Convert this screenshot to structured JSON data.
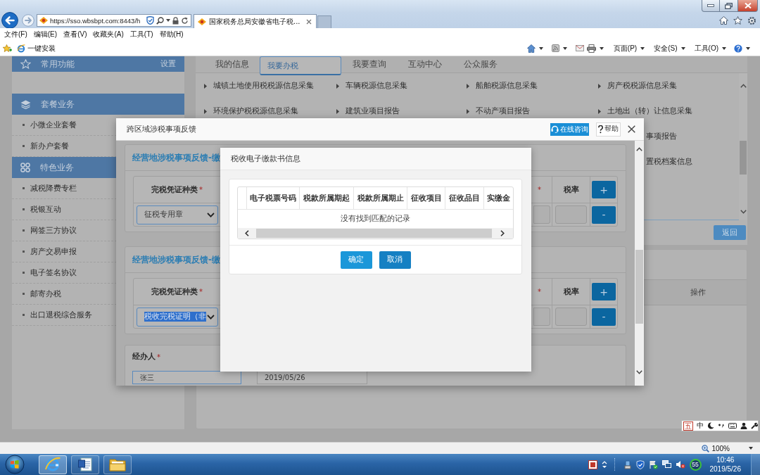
{
  "browser": {
    "address": "https://sso.wbsbpt.com:8443/h",
    "tab_title": "国家税务总局安徽省电子税...",
    "menu": [
      "文件(F)",
      "编辑(E)",
      "查看(V)",
      "收藏夹(A)",
      "工具(T)",
      "帮助(H)"
    ],
    "favorites": [
      "一键安装"
    ],
    "commands": [
      "页面(P)",
      "安全(S)",
      "工具(O)"
    ]
  },
  "sidebar": {
    "sections": [
      {
        "title": "常用功能",
        "action": "设置"
      },
      {
        "title": "套餐业务",
        "items": [
          "小微企业套餐",
          "新办户套餐"
        ]
      },
      {
        "title": "特色业务",
        "items": [
          "减税降费专栏",
          "税银互动",
          "网签三方协议",
          "房产交易申报",
          "电子签名协议",
          "邮寄办税",
          "出口退税综合服务"
        ]
      }
    ]
  },
  "main": {
    "tabs": [
      {
        "label": "我的信息",
        "selected": false
      },
      {
        "label": "我要办税",
        "selected": true
      },
      {
        "label": "我要查询",
        "selected": false
      },
      {
        "label": "互动中心",
        "selected": false
      },
      {
        "label": "公众服务",
        "selected": false
      }
    ],
    "services": [
      {
        "items": [
          {
            "kind": "link",
            "label": "城镇土地使用税税源信息采集"
          },
          {
            "kind": "link",
            "label": "车辆税源信息采集"
          },
          {
            "kind": "link",
            "label": "船舶税源信息采集"
          },
          {
            "kind": "link",
            "label": "房产税税源信息采集"
          }
        ]
      },
      {
        "items": [
          {
            "kind": "link",
            "label": "环境保护税税源信息采集"
          },
          {
            "kind": "link",
            "label": "建筑业项目报告"
          },
          {
            "kind": "link",
            "label": "不动产项目报告"
          },
          {
            "kind": "link",
            "label": "土地出（转）让信息采集"
          }
        ]
      },
      {
        "items": [
          {
            "kind": "tail",
            "label": "事项报告"
          }
        ]
      },
      {
        "items": [
          {
            "kind": "tail",
            "label": "置税档案信息"
          }
        ]
      }
    ],
    "back_button": "返回",
    "table": {
      "columns": [
        "操作"
      ]
    }
  },
  "dialog": {
    "title": "跨区域涉税事项反馈",
    "consult_button": "在线咨询",
    "help_button": "帮助",
    "sections": [
      {
        "heading": "经营地涉税事项反馈-缴",
        "columns": [
          {
            "kind": "select",
            "label": "完税凭证种类",
            "mark": "*"
          },
          {
            "kind": "stub",
            "mark": "*"
          },
          {
            "kind": "input",
            "label": "税率"
          }
        ],
        "voucher": {
          "value": "征税专用章",
          "highlighted": false
        },
        "add_button": "+",
        "remove_button": "-"
      },
      {
        "heading": "经营地涉税事项反馈-缴",
        "columns": [
          {
            "kind": "select",
            "label": "完税凭证种类",
            "mark": "*"
          },
          {
            "kind": "stub",
            "mark": "*"
          },
          {
            "kind": "input",
            "label": "税率"
          }
        ],
        "voucher": {
          "value": "税收完税证明（非",
          "highlighted": true
        },
        "add_button": "+",
        "remove_button": "-"
      }
    ],
    "handler": {
      "label": "经办人",
      "mark": "*",
      "name": "张三",
      "date": "2019/05/26"
    }
  },
  "records_dialog": {
    "title": "税收电子缴款书信息",
    "columns": [
      "电子税票号码",
      "税款所属期起",
      "税款所属期止",
      "征收项目",
      "征收品目",
      "实缴金"
    ],
    "empty_message": "没有找到匹配的记录",
    "buttons": [
      {
        "kind": "primary",
        "label": "确定"
      },
      {
        "kind": "secondary",
        "label": "取消"
      }
    ]
  },
  "ime_bar": {
    "method": "五",
    "mode": "中"
  },
  "status_bar": {
    "zoom": "100%"
  },
  "taskbar": {
    "tray_badge": "55",
    "time": "10:46",
    "date": "2019/5/26"
  }
}
